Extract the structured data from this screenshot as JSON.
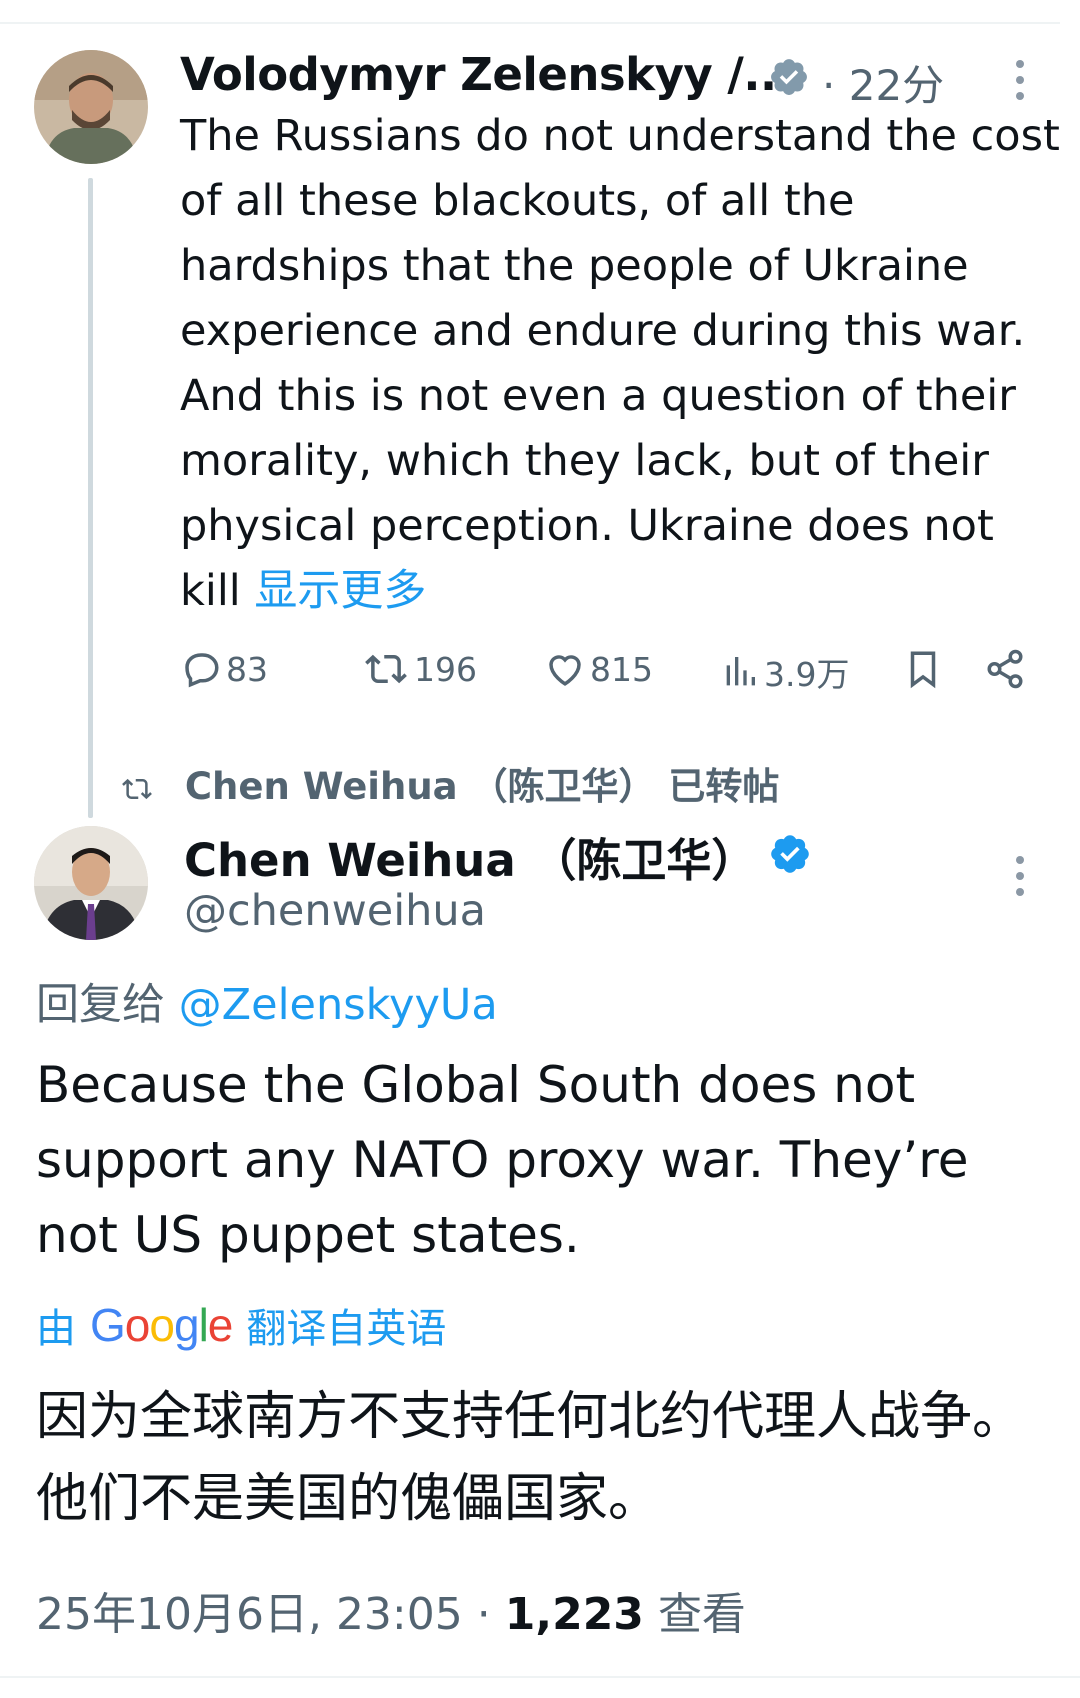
{
  "tweet1": {
    "author_name": "Volodymyr Zelenskyy /...",
    "separator": "·",
    "time": "22分",
    "text": "The Russians do not understand the cost of all these blackouts, of all the hardships that the people of Ukraine experience and endure during this war. And this is not even a question of their morality, which they lack, but of their physical perception. Ukraine does not kill ",
    "show_more": "显示更多",
    "replies": "83",
    "retweets": "196",
    "likes": "815",
    "views": "3.9万"
  },
  "retweet_notice": {
    "text": "Chen Weihua （陈卫华） 已转帖"
  },
  "tweet2": {
    "author_name": "Chen Weihua （陈卫华）",
    "handle": "@chenweihua",
    "reply_prefix": "回复给",
    "reply_handle": "@ZelenskyyUa",
    "text": "Because the Global South does not support any NATO proxy war. They’re not US puppet states.",
    "translated_prefix": "由",
    "translated_brand": "Google",
    "translated_suffix": "翻译自英语",
    "translation": "因为全球南方不支持任何北约代理人战争。他们不是美国的傀儡国家。",
    "timestamp": "25年10月6日, 23:05",
    "separator": "·",
    "views_count": "1,223",
    "views_label": "查看"
  },
  "colors": {
    "accent": "#1d9bf0",
    "secondary_text": "#536471",
    "verified_gray": "#829aab",
    "thread_line": "#cfd9de"
  },
  "icons": [
    "verified-badge-icon",
    "more-icon",
    "reply-icon",
    "retweet-icon",
    "like-icon",
    "views-icon",
    "bookmark-icon",
    "share-icon",
    "retweet-small-icon"
  ]
}
